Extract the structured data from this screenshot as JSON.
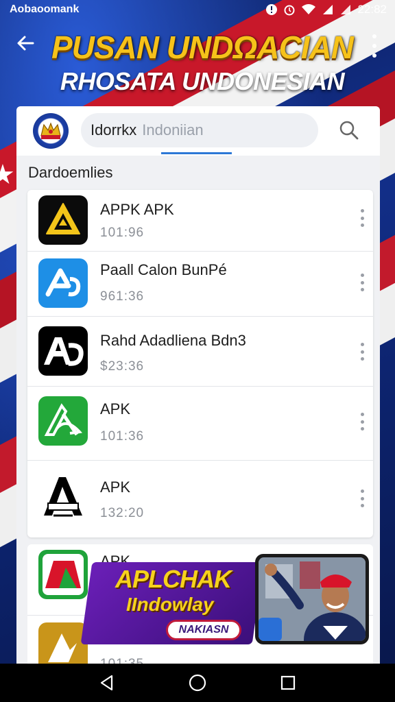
{
  "status_bar": {
    "carrier": "Aobaoomank",
    "time": "22:82"
  },
  "header": {
    "title": "PUSAN UNDΩACIAN",
    "subtitle": "RHOSATA UNDONESIAN"
  },
  "search": {
    "value": "Idorrkx",
    "placeholder": "Indoniian"
  },
  "section_label": "Dardoemlies",
  "apps": [
    {
      "name": "APPK APK",
      "meta": "101:96",
      "icon": "warning-triangle-icon",
      "color": "#0a0a0a"
    },
    {
      "name": "Paall Calon BunPé",
      "meta": "961:36",
      "icon": "app-store-icon",
      "color": "#1e8fe6"
    },
    {
      "name": "Rahd Adadliena Bdn3",
      "meta": "$23:36",
      "icon": "ap-logo-icon",
      "color": "#000000"
    },
    {
      "name": "APK",
      "meta": "101:36",
      "icon": "green-a-icon",
      "color": "#23a83a"
    },
    {
      "name": "APK",
      "meta": "132:20",
      "icon": "black-a-icon",
      "color": "#ffffff"
    },
    {
      "name": "APK",
      "meta": "",
      "icon": "red-green-icon",
      "color": "#1fa33a"
    },
    {
      "name": "",
      "meta": "101:35",
      "icon": "gold-a-icon",
      "color": "#c9951a"
    }
  ],
  "promo": {
    "title_line1": "APLCHAK",
    "title_line2": "IIndowlay",
    "button": "NAKIASN"
  },
  "colors": {
    "accent": "#2d78d6",
    "title_gold": "#f6c21a",
    "flag_red": "#c8182a"
  }
}
